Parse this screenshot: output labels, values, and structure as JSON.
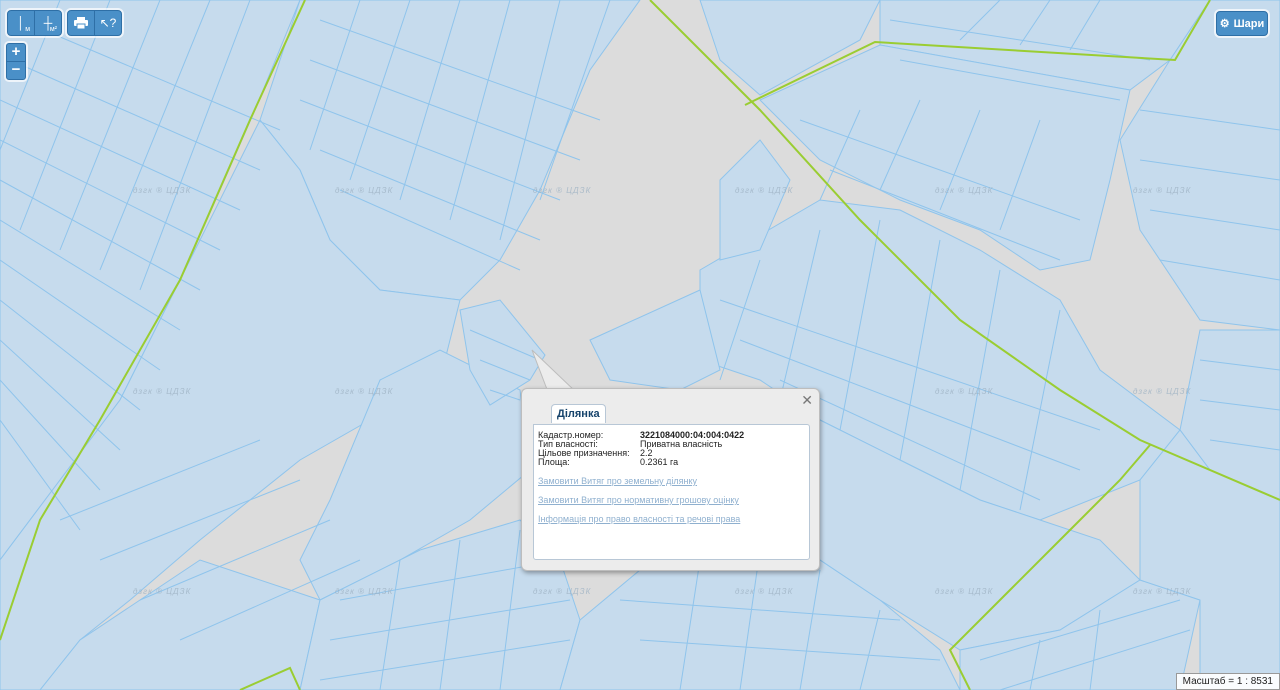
{
  "toolbar": {
    "measure_line_sub": "м",
    "measure_area_sub": "м²",
    "print_icon": "printer-icon",
    "info_icon": "cursor-help-icon"
  },
  "zoom": {
    "in_label": "+",
    "out_label": "−"
  },
  "layers_button": {
    "label": "Шари",
    "icon": "gear-icon"
  },
  "watermark_text": "дзгк ® ЦДЗК",
  "popup": {
    "tab_label": "Ділянка",
    "fields": [
      {
        "key": "Кадастр.номер:",
        "value": "3221084000:04:004:0422",
        "bold": true
      },
      {
        "key": "Тип власності:",
        "value": "Приватна власність"
      },
      {
        "key": "Цільове призначення:",
        "value": "2.2"
      },
      {
        "key": "Площа:",
        "value": "0.2361 га"
      }
    ],
    "links": [
      "Замовити Витяг про земельну ділянку",
      "Замовити Витяг про нормативну грошову оцінку",
      "Інформація про право власності та речові права"
    ]
  },
  "scale_text": "Масштаб = 1 : 8531",
  "colors": {
    "map_background": "#dcdcdc",
    "parcel_fill": "#c6dbed",
    "parcel_stroke": "#8fc4ec",
    "boundary_line": "#9acd32",
    "button_blue": "#4a90c8"
  }
}
